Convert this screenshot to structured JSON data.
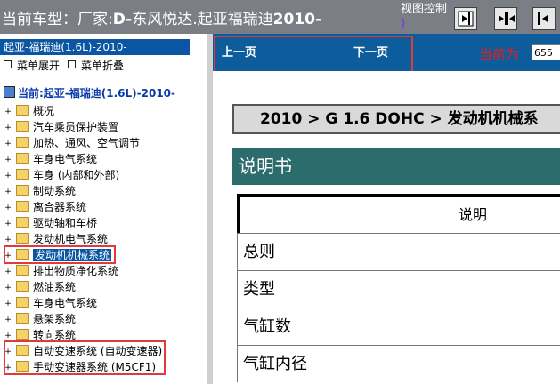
{
  "titlebar": {
    "prefix": "当前车型：厂家:",
    "bold_d": "D-",
    "middle": "东风悦达.起亚福瑞迪",
    "year": "2010-",
    "view_control_label": "视图控制",
    "buttons": [
      "view-split-right",
      "view-split-both",
      "view-split-left"
    ]
  },
  "left_pane": {
    "car_header": "起亚-福瑞迪(1.6L)-2010-",
    "expand_label": "菜单展开",
    "collapse_label": "菜单折叠",
    "tree_root": "当前:起亚-福瑞迪(1.6L)-2010-",
    "tree_items": [
      {
        "label": "概况"
      },
      {
        "label": "汽车乘员保护装置"
      },
      {
        "label": "加热、通风、空气调节"
      },
      {
        "label": "车身电气系统"
      },
      {
        "label": "车身 (内部和外部)"
      },
      {
        "label": "制动系统"
      },
      {
        "label": "离合器系统"
      },
      {
        "label": "驱动轴和车桥"
      },
      {
        "label": "发动机电气系统"
      },
      {
        "label": "发动机机械系统"
      },
      {
        "label": "排出物质净化系统"
      },
      {
        "label": "燃油系统"
      },
      {
        "label": "车身电气系统"
      },
      {
        "label": "悬架系统"
      },
      {
        "label": "转向系统"
      },
      {
        "label": "自动变速系统 (自动变速器)"
      },
      {
        "label": "手动变速器系统 (M5CF1)"
      }
    ],
    "selected_index": 9
  },
  "nav": {
    "prev": "上一页",
    "next": "下一页",
    "current_label": "当前为",
    "page_value": "655"
  },
  "content": {
    "breadcrumb": "2010 > G 1.6 DOHC > 发动机机械系",
    "section_title": "说明书",
    "table_header": "说明",
    "rows": [
      "总则",
      "类型",
      "气缸数",
      "气缸内径"
    ]
  },
  "colors": {
    "selection": "#0a56a3",
    "highlight_box": "#e23a3a",
    "section_bar": "#2d6c6c"
  }
}
